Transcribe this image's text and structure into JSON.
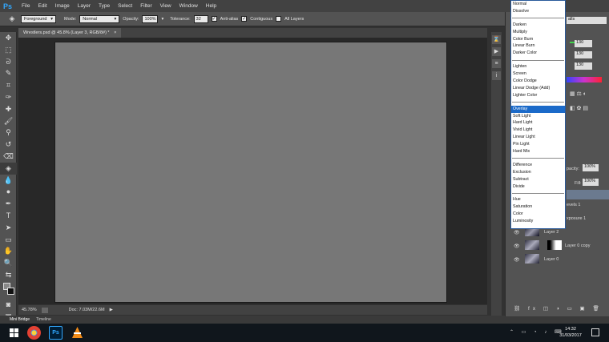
{
  "app": {
    "logo": "Ps"
  },
  "menu": [
    "File",
    "Edit",
    "Image",
    "Layer",
    "Type",
    "Select",
    "Filter",
    "View",
    "Window",
    "Help"
  ],
  "options": {
    "fill_source": "Foreground",
    "mode_label": "Mode:",
    "mode_value": "Normal",
    "opacity_label": "Opacity:",
    "opacity_value": "100%",
    "tolerance_label": "Tolerance:",
    "tolerance_value": "32",
    "antialias_label": "Anti-alias",
    "contiguous_label": "Contiguous",
    "all_layers_label": "All Layers",
    "blend_suffix": "alls"
  },
  "document": {
    "tab_title": "Wrestlers.psd @ 45.8% (Layer 3, RGB/8#) *",
    "zoom": "45.78%",
    "doc_size": "Doc: 7.03M/22.6M"
  },
  "bottom_tabs": [
    "Mini Bridge",
    "Timeline"
  ],
  "blend_dropdown": {
    "groups": [
      [
        "Normal",
        "Dissolve"
      ],
      [
        "Darken",
        "Multiply",
        "Color Burn",
        "Linear Burn",
        "Darker Color"
      ],
      [
        "Lighten",
        "Screen",
        "Color Dodge",
        "Linear Dodge (Add)",
        "Lighter Color"
      ],
      [
        "Overlay",
        "Soft Light",
        "Hard Light",
        "Vivid Light",
        "Linear Light",
        "Pin Light",
        "Hard Mix"
      ],
      [
        "Difference",
        "Exclusion",
        "Subtract",
        "Divide"
      ],
      [
        "Hue",
        "Saturation",
        "Color",
        "Luminosity"
      ]
    ],
    "selected": "Overlay"
  },
  "color_panel": {
    "values": [
      "130",
      "130",
      "130"
    ]
  },
  "layers_panel": {
    "opacity_label": "pacity:",
    "opacity_value": "100%",
    "fill_label": "Fill:",
    "fill_value": "100%",
    "layers": [
      "evels 1",
      "xposure 1",
      "Layer 2",
      "Layer 0 copy",
      "Layer 0"
    ]
  },
  "taskbar": {
    "time": "14:32",
    "date": "31/03/2017"
  },
  "colors": {
    "accent": "#1b6ac9",
    "panel": "#535353",
    "canvas": "#777777",
    "ps_blue": "#31a8ff"
  }
}
